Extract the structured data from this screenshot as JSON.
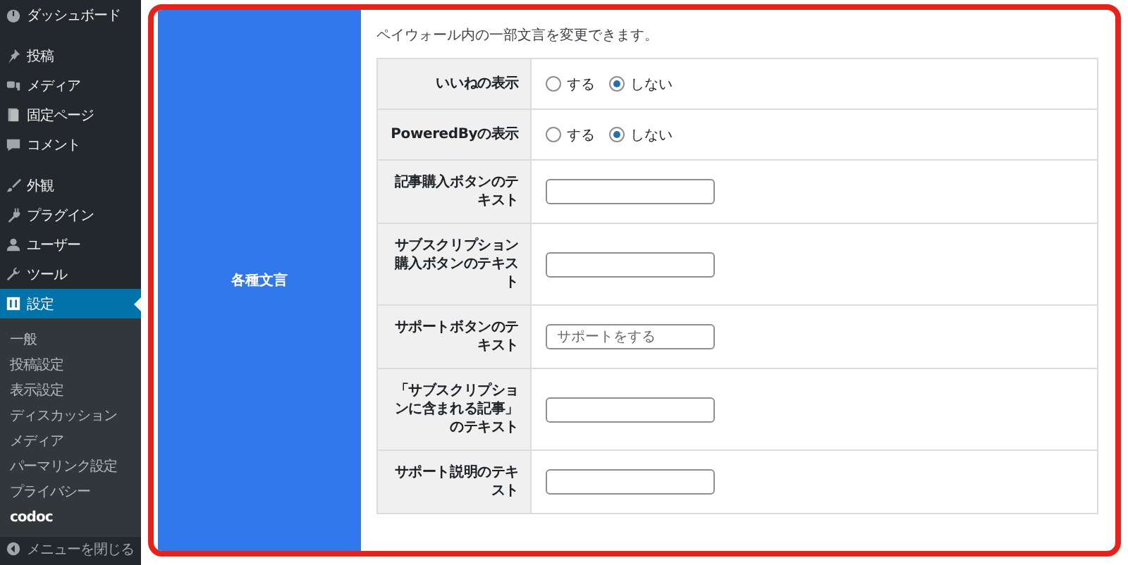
{
  "sidebar": {
    "sections": [
      [
        {
          "label": "ダッシュボード",
          "selected": false
        }
      ],
      [
        {
          "label": "投稿",
          "selected": false
        },
        {
          "label": "メディア",
          "selected": false
        },
        {
          "label": "固定ページ",
          "selected": false
        },
        {
          "label": "コメント",
          "selected": false
        }
      ],
      [
        {
          "label": "外観",
          "selected": false
        },
        {
          "label": "プラグイン",
          "selected": false
        },
        {
          "label": "ユーザー",
          "selected": false
        },
        {
          "label": "ツール",
          "selected": false
        },
        {
          "label": "設定",
          "selected": true
        }
      ]
    ],
    "submenu": [
      {
        "label": "一般",
        "selected": false
      },
      {
        "label": "投稿設定",
        "selected": false
      },
      {
        "label": "表示設定",
        "selected": false
      },
      {
        "label": "ディスカッション",
        "selected": false
      },
      {
        "label": "メディア",
        "selected": false
      },
      {
        "label": "パーマリンク設定",
        "selected": false
      },
      {
        "label": "プライバシー",
        "selected": false
      },
      {
        "label": "codoc",
        "selected": true
      }
    ],
    "collapse": "メニューを閉じる"
  },
  "panel": {
    "section_label": "各種文言",
    "description": "ペイウォール内の一部文言を変更できます。",
    "rows": [
      {
        "label": "いいねの表示",
        "kind": "radio",
        "options": [
          {
            "label": "する",
            "selected": false
          },
          {
            "label": "しない",
            "selected": true
          }
        ]
      },
      {
        "label": "PoweredByの表示",
        "kind": "radio",
        "options": [
          {
            "label": "する",
            "selected": false
          },
          {
            "label": "しない",
            "selected": true
          }
        ]
      },
      {
        "label": "記事購入ボタンのテキスト",
        "kind": "text"
      },
      {
        "label": "サブスクリプション購入ボタンのテキスト",
        "kind": "text"
      },
      {
        "label": "サポートボタンのテキスト",
        "kind": "text",
        "placeholder": "サポートをする"
      },
      {
        "label": "「サブスクリプションに含まれる記事」のテキスト",
        "kind": "text"
      },
      {
        "label": "サポート説明のテキスト",
        "kind": "text"
      }
    ]
  }
}
